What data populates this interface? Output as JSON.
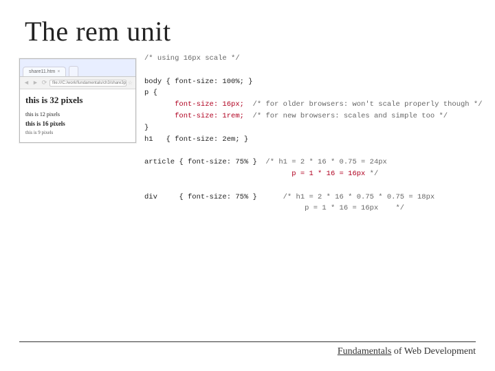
{
  "title": "The rem unit",
  "browser_mock": {
    "tab_label": "share11.htm",
    "url_text": "file:///C:/work/fundamentals/ch3/share3p...",
    "page": {
      "h32": "this is 32 pixels",
      "p12": "this is 12 pixels",
      "h16": "this is 16 pixels",
      "p9": "this is 9 pixels"
    }
  },
  "code": {
    "l1": "/* using 16px scale */",
    "l2": "body { font-size: 100%; }",
    "l3": "p {",
    "l4a": "       font-size: 16px;",
    "l4b": "  /* for older browsers: won't scale properly though */",
    "l5a": "       font-size: 1rem;",
    "l5b": "  /* for new browsers: scales and simple too */",
    "l6": "}",
    "l7": "h1   { font-size: 2em; }",
    "l8a": "article { font-size: 75% }",
    "l8b": "  /* h1 = 2 * 16 * 0.75 = 24px",
    "l8c": "                                  p = 1 * 16 = 16px",
    "l8d": " */",
    "l9a": "div     { font-size: 75% }",
    "l9b": "      /* h1 = 2 * 16 * 0.75 * 0.75 = 18px",
    "l9c": "                                     p = 1 * 16 = 16px    */"
  },
  "footer": {
    "underlined": "Fundamentals",
    "rest": " of Web Development"
  }
}
